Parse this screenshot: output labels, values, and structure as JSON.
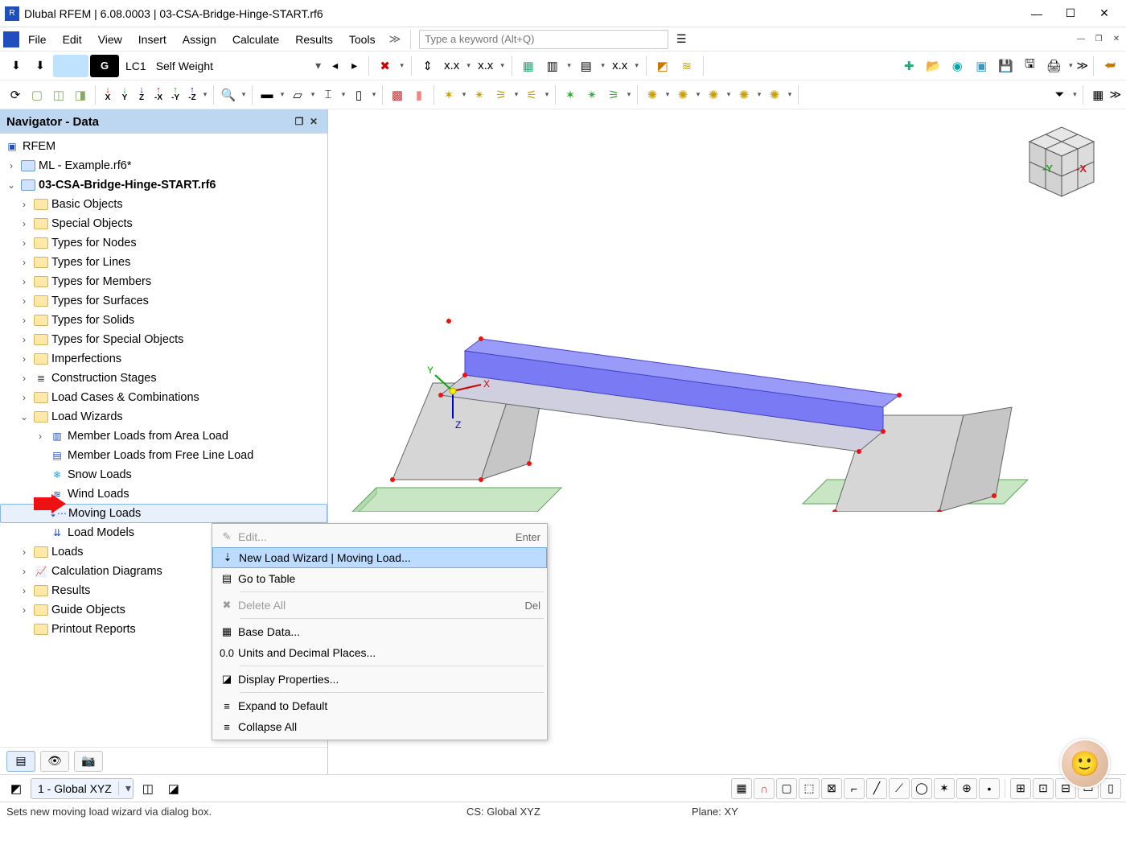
{
  "title": "Dlubal RFEM | 6.08.0003 | 03-CSA-Bridge-Hinge-START.rf6",
  "menu": {
    "items": [
      "File",
      "Edit",
      "View",
      "Insert",
      "Assign",
      "Calculate",
      "Results",
      "Tools"
    ]
  },
  "search": {
    "placeholder": "Type a keyword (Alt+Q)"
  },
  "loadcase": {
    "g": "G",
    "lc": "LC1",
    "name": "Self Weight"
  },
  "navigator": {
    "title": "Navigator - Data",
    "root": "RFEM",
    "files": [
      {
        "label": "ML - Example.rf6*",
        "bold": false
      },
      {
        "label": "03-CSA-Bridge-Hinge-START.rf6",
        "bold": true
      }
    ],
    "groups": [
      "Basic Objects",
      "Special Objects",
      "Types for Nodes",
      "Types for Lines",
      "Types for Members",
      "Types for Surfaces",
      "Types for Solids",
      "Types for Special Objects",
      "Imperfections",
      "Construction Stages",
      "Load Cases & Combinations"
    ],
    "loadwizards": {
      "label": "Load Wizards",
      "children": [
        "Member Loads from Area Load",
        "Member Loads from Free Line Load",
        "Snow Loads",
        "Wind Loads",
        "Moving Loads",
        "Load Models"
      ],
      "selected": "Moving Loads"
    },
    "tail": [
      "Loads",
      "Calculation Diagrams",
      "Results",
      "Guide Objects",
      "Printout Reports"
    ]
  },
  "context": {
    "items": [
      {
        "label": "Edit...",
        "accel": "Enter",
        "disabled": true,
        "icon": "✎"
      },
      {
        "label": "New Load Wizard | Moving Load...",
        "highlight": true,
        "icon": "⇣"
      },
      {
        "label": "Go to Table",
        "icon": "▤"
      },
      {
        "sep": true
      },
      {
        "label": "Delete All",
        "accel": "Del",
        "disabled": true,
        "icon": "✖"
      },
      {
        "sep": true
      },
      {
        "label": "Base Data...",
        "icon": "▦"
      },
      {
        "label": "Units and Decimal Places...",
        "icon": "0.0"
      },
      {
        "sep": true
      },
      {
        "label": "Display Properties...",
        "icon": "◪"
      },
      {
        "sep": true
      },
      {
        "label": "Expand to Default",
        "icon": "≡"
      },
      {
        "label": "Collapse All",
        "icon": "≡"
      }
    ]
  },
  "bottom": {
    "cs_combo": "1 - Global XYZ"
  },
  "status": {
    "hint": "Sets new moving load wizard via dialog box.",
    "cs": "CS: Global XYZ",
    "plane": "Plane: XY"
  }
}
